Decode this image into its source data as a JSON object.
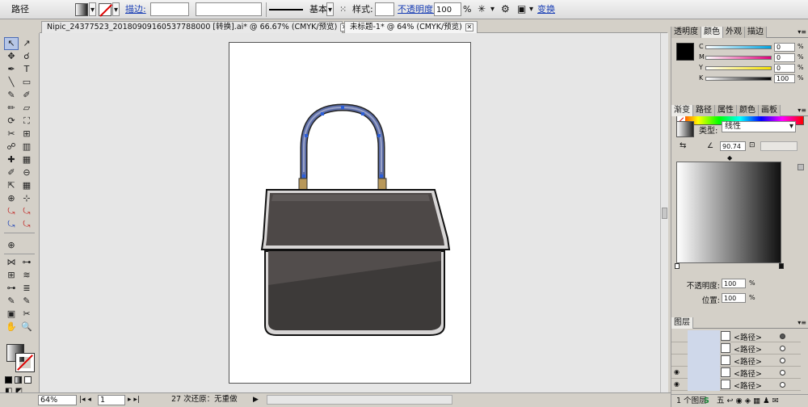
{
  "control_bar": {
    "object_type": "路径",
    "stroke_label": "描边:",
    "brush_label": "基本",
    "style_label": "样式:",
    "opacity_label": "不透明度:",
    "opacity_value": "100",
    "opacity_unit": "%",
    "transform_label": "变换"
  },
  "tabs": [
    {
      "label": "Nipic_24377523_20180909160537788000 [转换].ai* @ 66.67% (CMYK/预览)",
      "active": false
    },
    {
      "label": "未标题-1* @ 64% (CMYK/预览)",
      "active": true
    }
  ],
  "tools": [
    "↖",
    "↗",
    "✥",
    "☌",
    "✒",
    "T",
    "╲",
    "▭",
    "✎",
    "✐",
    "✏",
    "▱",
    "⟳",
    "⛶",
    "✂",
    "⊞",
    "☍",
    "▥",
    "✚",
    "▦",
    "✐",
    "⊖",
    "⇱",
    "▦",
    "⊕",
    "⊹",
    "⤿",
    "⤿",
    "⤿",
    "⤿",
    "⊕",
    "",
    "⋈",
    "⊶",
    "⊞",
    "≋",
    "⊶",
    "≣",
    "✎",
    "✎",
    "▣",
    "✂",
    "✋",
    "🔍"
  ],
  "canvas": {
    "bag_colors": {
      "body": "#524d4c",
      "body_dark": "#3d3a39",
      "flap": "#4d4847",
      "rim": "#d8d6d6",
      "handle": "#5b6ca6",
      "handle_light": "#9aa3c8",
      "clasp": "#b8985a",
      "anchor": "#2b5ed8"
    }
  },
  "status_bar": {
    "zoom": "64%",
    "artboard": "1",
    "history": "27 次还原：无重做"
  },
  "panels": {
    "color_tabs": [
      "透明度",
      "颜色",
      "外观",
      "描边"
    ],
    "cmyk": [
      {
        "label": "C",
        "value": "0",
        "unit": "%"
      },
      {
        "label": "M",
        "value": "0",
        "unit": "%"
      },
      {
        "label": "Y",
        "value": "0",
        "unit": "%"
      },
      {
        "label": "K",
        "value": "100",
        "unit": "%"
      }
    ],
    "gradient_tabs": [
      "渐变",
      "路径",
      "属性",
      "颜色",
      "画板"
    ],
    "gradient": {
      "type_label": "类型:",
      "type_value": "线性",
      "angle_value": "90.74",
      "opacity_label": "不透明度:",
      "opacity_value": "100",
      "position_label": "位置:",
      "position_value": "100",
      "unit": "%"
    },
    "layers_tab": "图层",
    "layers": [
      {
        "name": "<路径>",
        "target_on": true
      },
      {
        "name": "<路径>",
        "target_on": false
      },
      {
        "name": "<路径>",
        "target_on": false
      },
      {
        "name": "<路径>",
        "target_on": false
      },
      {
        "name": "<路径>",
        "target_on": false
      }
    ],
    "layers_footer": "1 个图层"
  },
  "colors": {
    "selection_blue": "#4a6bb5",
    "link_blue": "#1a3fb5"
  }
}
